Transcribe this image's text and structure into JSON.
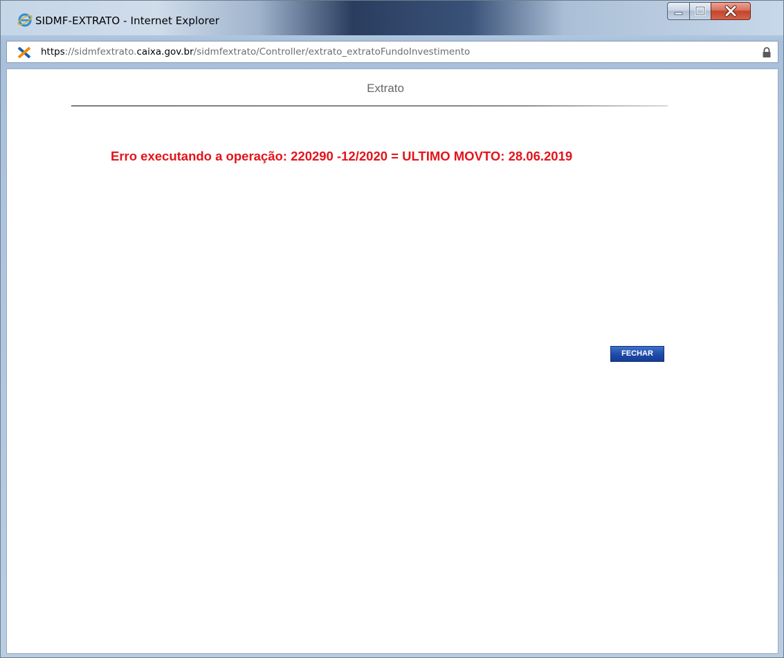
{
  "window": {
    "title": "SIDMF-EXTRATO - Internet Explorer",
    "icon": "internet-explorer-icon",
    "controls": [
      "minimize-icon",
      "maximize-icon",
      "close-icon"
    ]
  },
  "address_bar": {
    "site_icon": "caixa-icon",
    "url_scheme": "https",
    "url_sep": "://",
    "url_subdomain": "sidmfextrato.",
    "url_domain": "caixa.gov.br",
    "url_path": "/sidmfextrato/Controller/extrato_extratoFundoInvestimento",
    "secure_icon": "lock-icon"
  },
  "page": {
    "title": "Extrato",
    "error_message": "Erro executando a operação: 220290 -12/2020 = ULTIMO MOVTO: 28.06.2019",
    "close_button_label": "FECHAR"
  },
  "colors": {
    "error_text": "#e4141b",
    "button_bg": "#1e4aa8",
    "title_text": "#666666"
  }
}
